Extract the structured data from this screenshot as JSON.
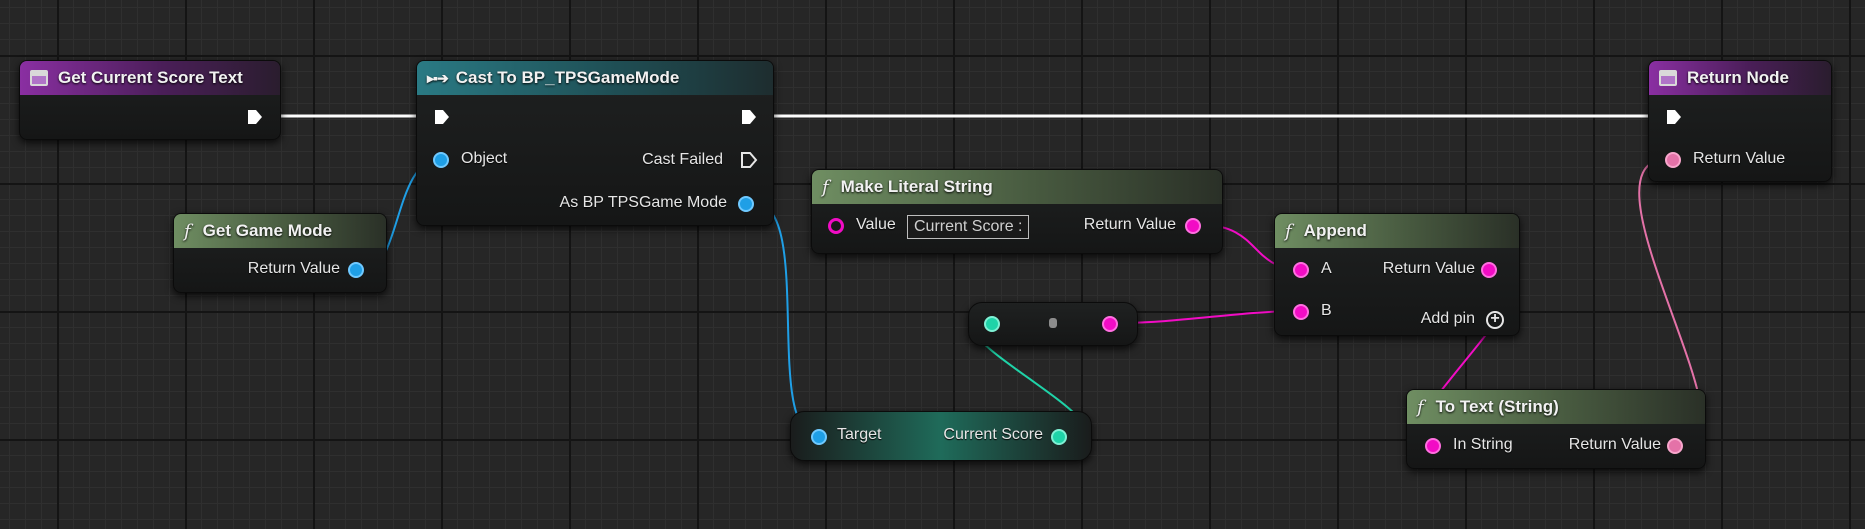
{
  "nodes": {
    "get_score": {
      "title": "Get Current Score Text"
    },
    "cast": {
      "title": "Cast To BP_TPSGameMode",
      "object_label": "Object",
      "cast_failed_label": "Cast Failed",
      "as_label": "As BP TPSGame Mode"
    },
    "return_node": {
      "title": "Return Node",
      "return_value_label": "Return Value"
    },
    "get_game_mode": {
      "title": "Get Game Mode",
      "return_value_label": "Return Value"
    },
    "make_literal": {
      "title": "Make Literal String",
      "value_label": "Value",
      "value_text": "Current Score :",
      "return_value_label": "Return Value"
    },
    "append": {
      "title": "Append",
      "a_label": "A",
      "b_label": "B",
      "return_value_label": "Return Value",
      "add_pin_label": "Add pin"
    },
    "current_score_get": {
      "target_label": "Target",
      "output_label": "Current Score"
    },
    "to_text": {
      "title": "To Text (String)",
      "in_label": "In String",
      "return_value_label": "Return Value"
    }
  },
  "colors": {
    "function_entry_header": "#8a2fa2",
    "cast_header": "#2a7a84",
    "pure_function_header": "#6f8e62",
    "object_pin": "#1f9fe6",
    "string_pin": "#f20cc5",
    "int_pin": "#1fd3a8",
    "text_pin": "#e472a8",
    "exec_wire": "#ffffff"
  },
  "icons": {
    "function_entry": "function-entry-icon",
    "cast": "cast-icon",
    "pure_function": "function-f-icon",
    "add_pin": "plus-circle-icon"
  }
}
